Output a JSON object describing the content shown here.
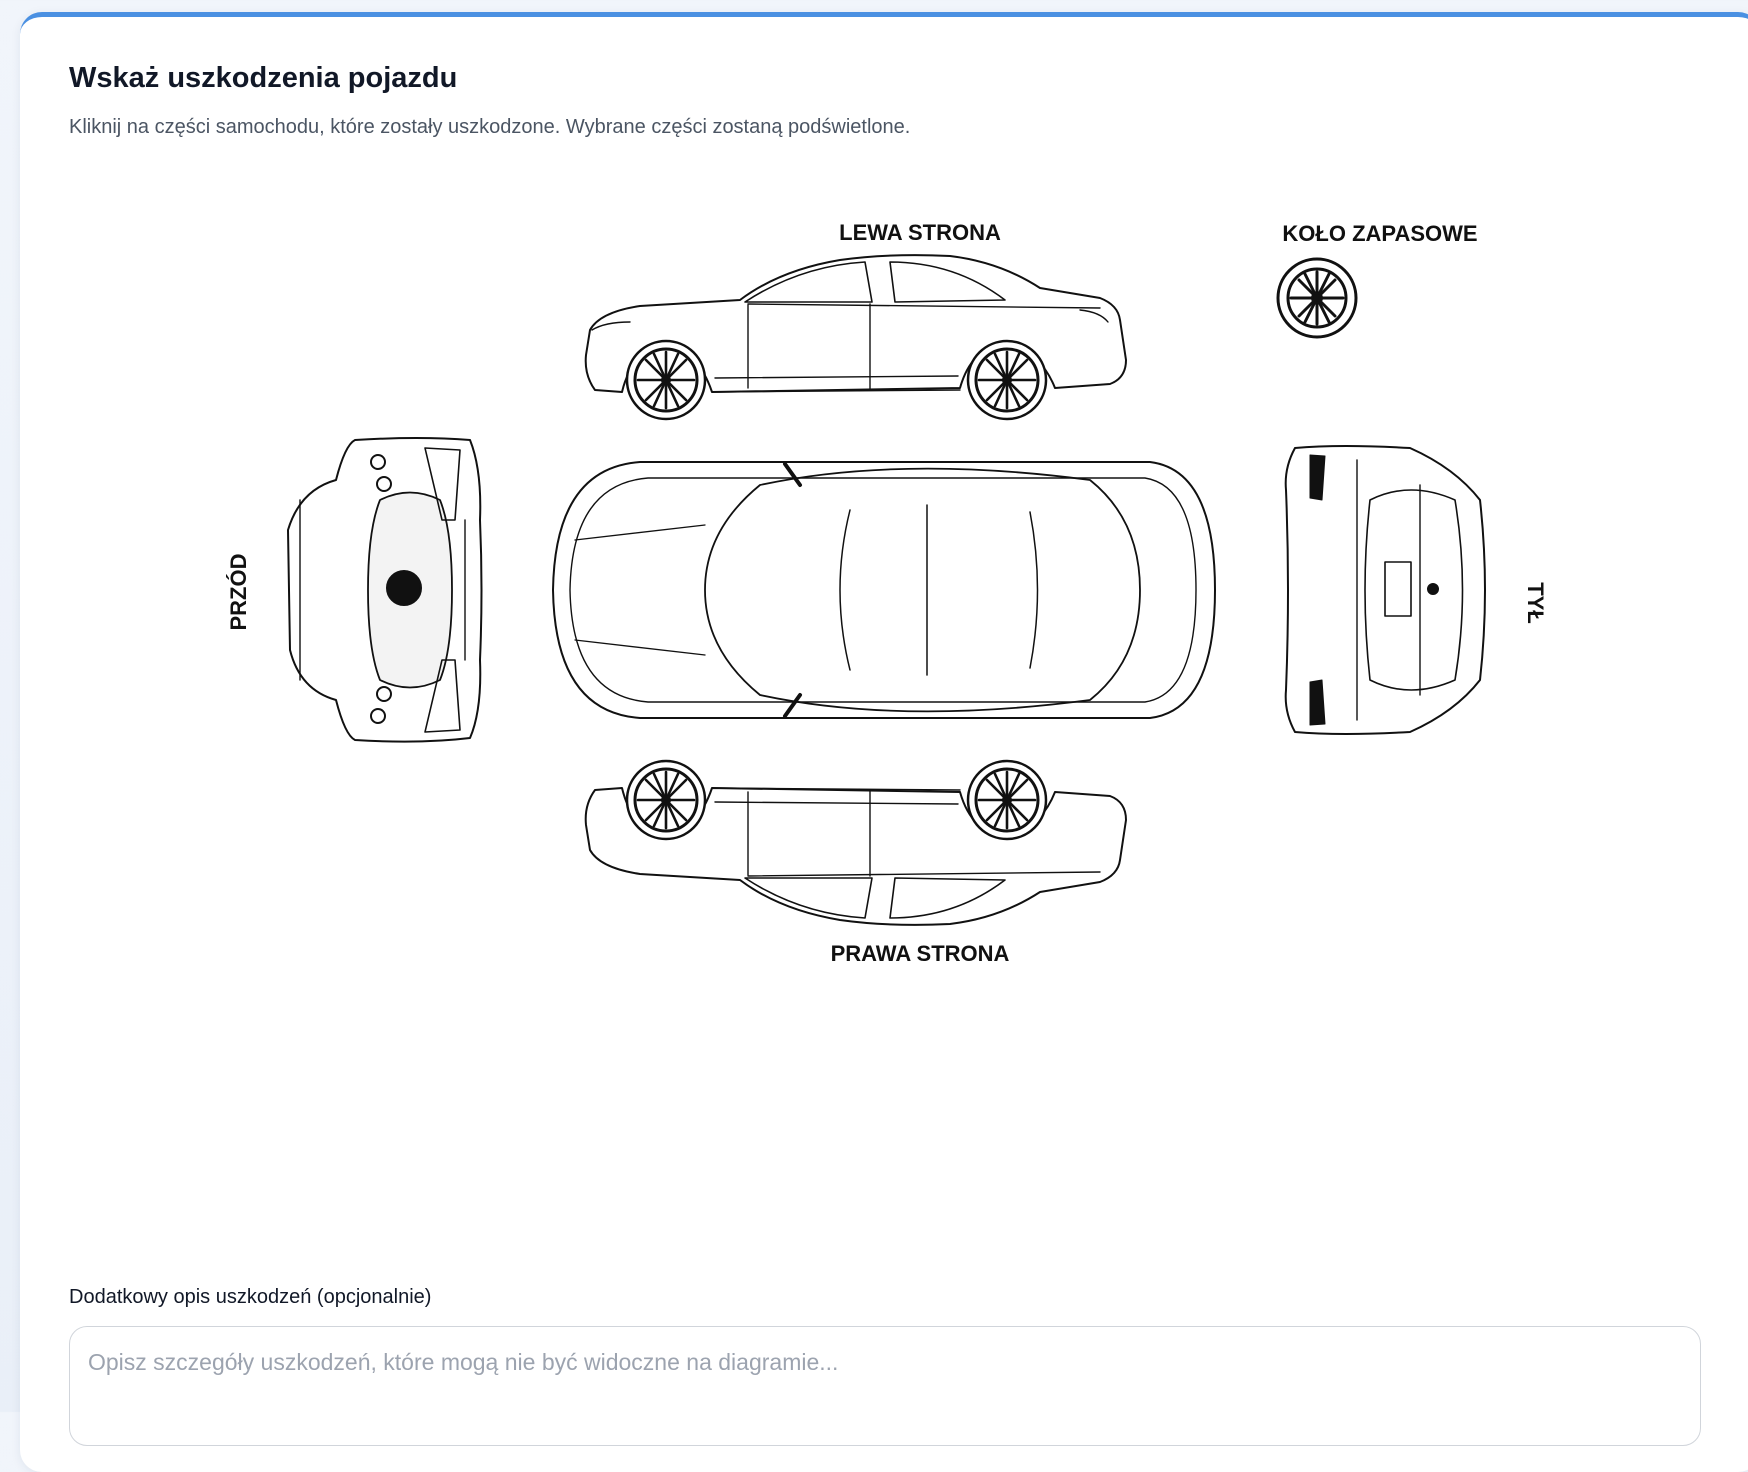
{
  "form": {
    "title": "Wskaż uszkodzenia pojazdu",
    "subtitle": "Kliknij na części samochodu, które zostały uszkodzone. Wybrane części zostaną podświetlone."
  },
  "diagram": {
    "labels": {
      "left_side": "LEWA STRONA",
      "spare_wheel": "KOŁO ZAPASOWE",
      "front": "PRZÓD",
      "rear": "TYŁ",
      "right_side": "PRAWA STRONA"
    }
  },
  "description": {
    "label": "Dodatkowy opis uszkodzeń (opcjonalnie)",
    "placeholder": "Opisz szczegóły uszkodzeń, które mogą nie być widoczne na diagramie...",
    "value": ""
  },
  "colors": {
    "accent": "#4a90e2",
    "line": "#111111",
    "placeholder": "#9ca3af"
  }
}
